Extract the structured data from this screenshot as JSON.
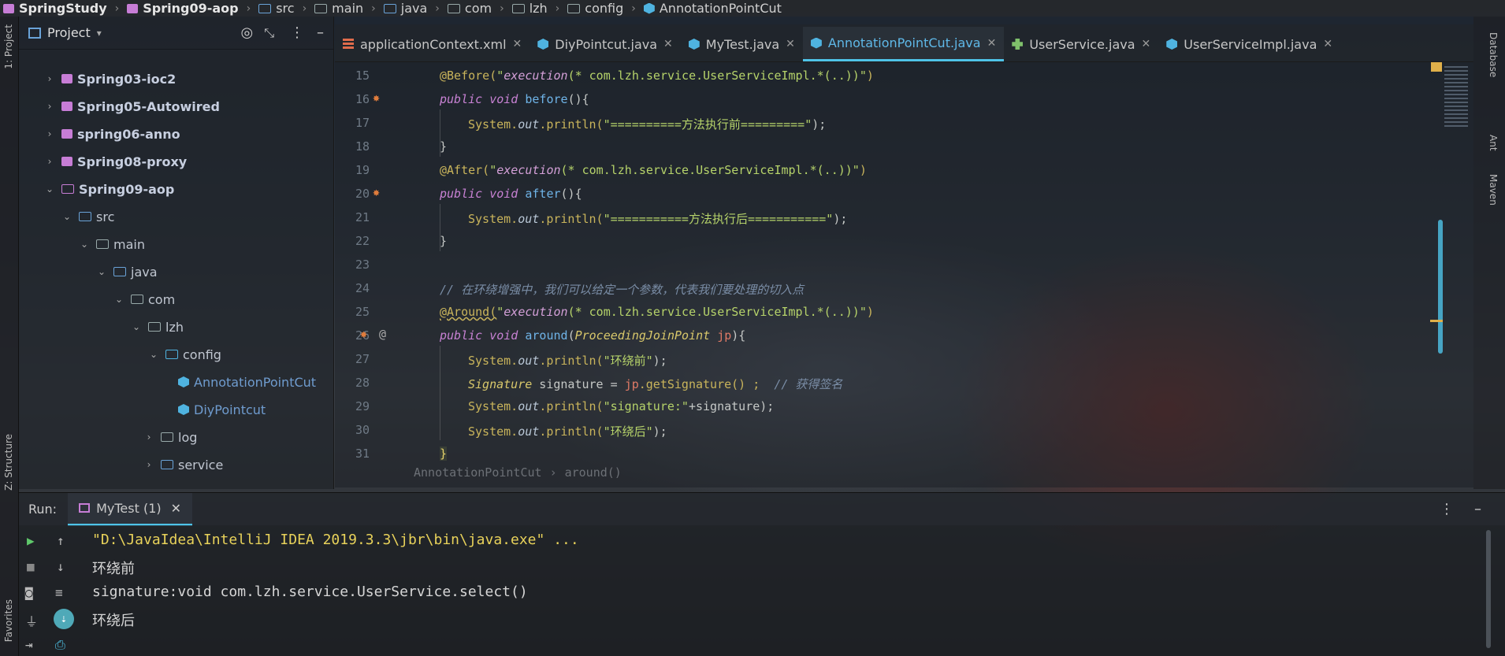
{
  "breadcrumb": [
    "SpringStudy",
    "Spring09-aop",
    "src",
    "main",
    "java",
    "com",
    "lzh",
    "config",
    "AnnotationPointCut"
  ],
  "left_strip": {
    "project_tab": "1: Project",
    "structure_tab": "Z: Structure",
    "favorites_tab": "Favorites"
  },
  "project_panel": {
    "title": "Project",
    "tree": [
      {
        "label": "Spring03-ioc2",
        "expanded": false
      },
      {
        "label": "Spring05-Autowired",
        "expanded": false
      },
      {
        "label": "spring06-anno",
        "expanded": false
      },
      {
        "label": "Spring08-proxy",
        "expanded": false
      },
      {
        "label": "Spring09-aop",
        "expanded": true
      },
      {
        "label": "src",
        "expanded": true
      },
      {
        "label": "main",
        "expanded": true
      },
      {
        "label": "java",
        "expanded": true
      },
      {
        "label": "com",
        "expanded": true
      },
      {
        "label": "lzh",
        "expanded": true
      },
      {
        "label": "config",
        "expanded": true
      },
      {
        "label": "AnnotationPointCut"
      },
      {
        "label": "DiyPointcut"
      },
      {
        "label": "log",
        "expanded": false
      },
      {
        "label": "service",
        "expanded": false
      }
    ]
  },
  "tabs": [
    {
      "label": "applicationContext.xml",
      "icon": "xml-file-icon",
      "active": false
    },
    {
      "label": "DiyPointcut.java",
      "icon": "java-class-icon",
      "active": false
    },
    {
      "label": "MyTest.java",
      "icon": "java-class-icon",
      "active": false
    },
    {
      "label": "AnnotationPointCut.java",
      "icon": "java-class-icon",
      "active": true
    },
    {
      "label": "UserService.java",
      "icon": "interface-icon",
      "active": false
    },
    {
      "label": "UserServiceImpl.java",
      "icon": "java-class-icon",
      "active": false
    }
  ],
  "editor": {
    "line_numbers": [
      "15",
      "16",
      "17",
      "18",
      "19",
      "20",
      "21",
      "22",
      "23",
      "24",
      "25",
      "26",
      "27",
      "28",
      "29",
      "30",
      "31"
    ],
    "code": {
      "l15_anno": "@Before(",
      "l15_str_open": "\"",
      "l15_exec": "execution",
      "l15_rest": "(* com.lzh.service.UserServiceImpl.*(..))\"",
      "l15_close": ")",
      "l16_kw": "public void ",
      "l16_fn": "before",
      "l16_rest": "(){",
      "l17_sys": "System.",
      "l17_out": "out",
      "l17_mid": ".println(",
      "l17_str": "\"==========方法执行前=========\"",
      "l17_end": ");",
      "l18": "}",
      "l19_anno": "@After(",
      "l19_exec": "execution",
      "l19_rest": "(* com.lzh.service.UserServiceImpl.*(..))\"",
      "l20_fn": "after",
      "l21_str": "\"===========方法执行后===========\"",
      "l22": "}",
      "l24_comment": "// 在环绕增强中，我们可以给定一个参数，代表我们要处理的切入点",
      "l25_anno": "@Around(",
      "l26_fn": "around",
      "l26_type": "ProceedingJoinPoint",
      "l26_param": "jp",
      "l26_rest": "){",
      "l27_str": "\"环绕前\"",
      "l28_type": "Signature",
      "l28_mid": " signature = ",
      "l28_jp": "jp",
      "l28_call": ".getSignature() ;  ",
      "l28_comment": "// 获得签名",
      "l29_str": "\"signature:\"",
      "l29_rest": "+signature);",
      "l30_str": "\"环绕后\"",
      "l31": "}"
    },
    "footer_breadcrumb": [
      "AnnotationPointCut",
      "around()"
    ]
  },
  "right_strip": {
    "database_tab": "Database",
    "ant_tab": "Ant",
    "maven_tab": "Maven"
  },
  "run_panel": {
    "label": "Run:",
    "tab": "MyTest (1)",
    "output": [
      "\"D:\\JavaIdea\\IntelliJ IDEA 2019.3.3\\jbr\\bin\\java.exe\" ...",
      "环绕前",
      "signature:void com.lzh.service.UserService.select()",
      "环绕后"
    ]
  },
  "colors": {
    "accent": "#4fc3e8",
    "annotation": "#c9b45b",
    "string": "#b6d36a",
    "keyword": "#c882d4"
  }
}
